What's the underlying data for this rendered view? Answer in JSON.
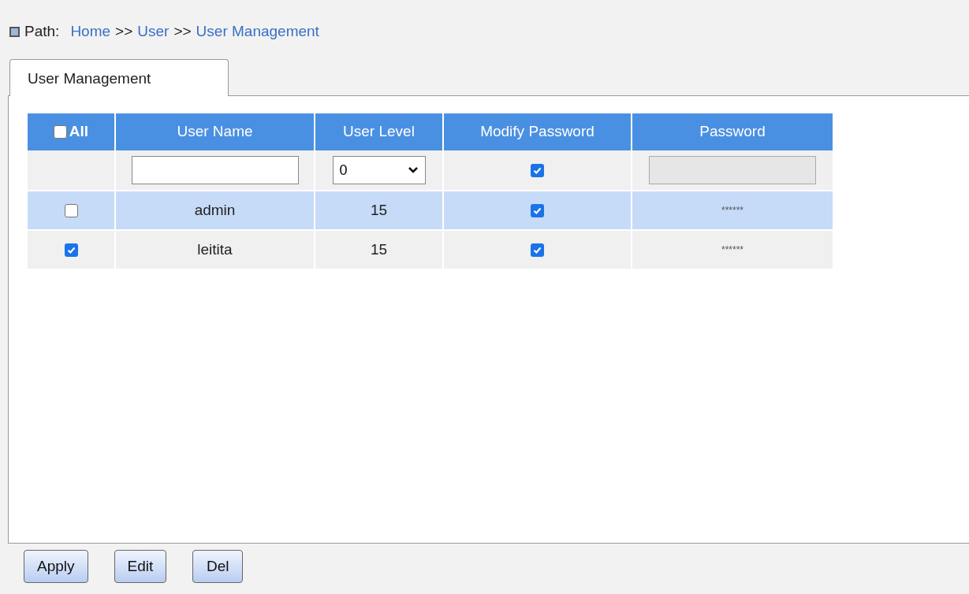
{
  "path": {
    "label": "Path:",
    "items": [
      {
        "kind": "link",
        "text": "Home"
      },
      {
        "kind": "separator",
        "text": ">>"
      },
      {
        "kind": "link",
        "text": "User"
      },
      {
        "kind": "separator",
        "text": ">>"
      },
      {
        "kind": "link",
        "text": "User Management"
      }
    ]
  },
  "tabs": [
    {
      "label": "User Management",
      "selected": true
    }
  ],
  "table": {
    "select_all": {
      "label": "All",
      "checked": false
    },
    "columns": [
      "User Name",
      "User Level",
      "Modify Password",
      "Password"
    ],
    "new_row": {
      "user_level": "0",
      "modify_password": true,
      "password_disabled": true
    },
    "rows": [
      {
        "checked": false,
        "highlighted": true,
        "user_name": "admin",
        "user_level": "15",
        "modify_password": true,
        "password": "******"
      },
      {
        "checked": true,
        "highlighted": false,
        "user_name": "leitita",
        "user_level": "15",
        "modify_password": true,
        "password": "******"
      }
    ]
  },
  "buttons": [
    "Apply",
    "Edit",
    "Del"
  ]
}
